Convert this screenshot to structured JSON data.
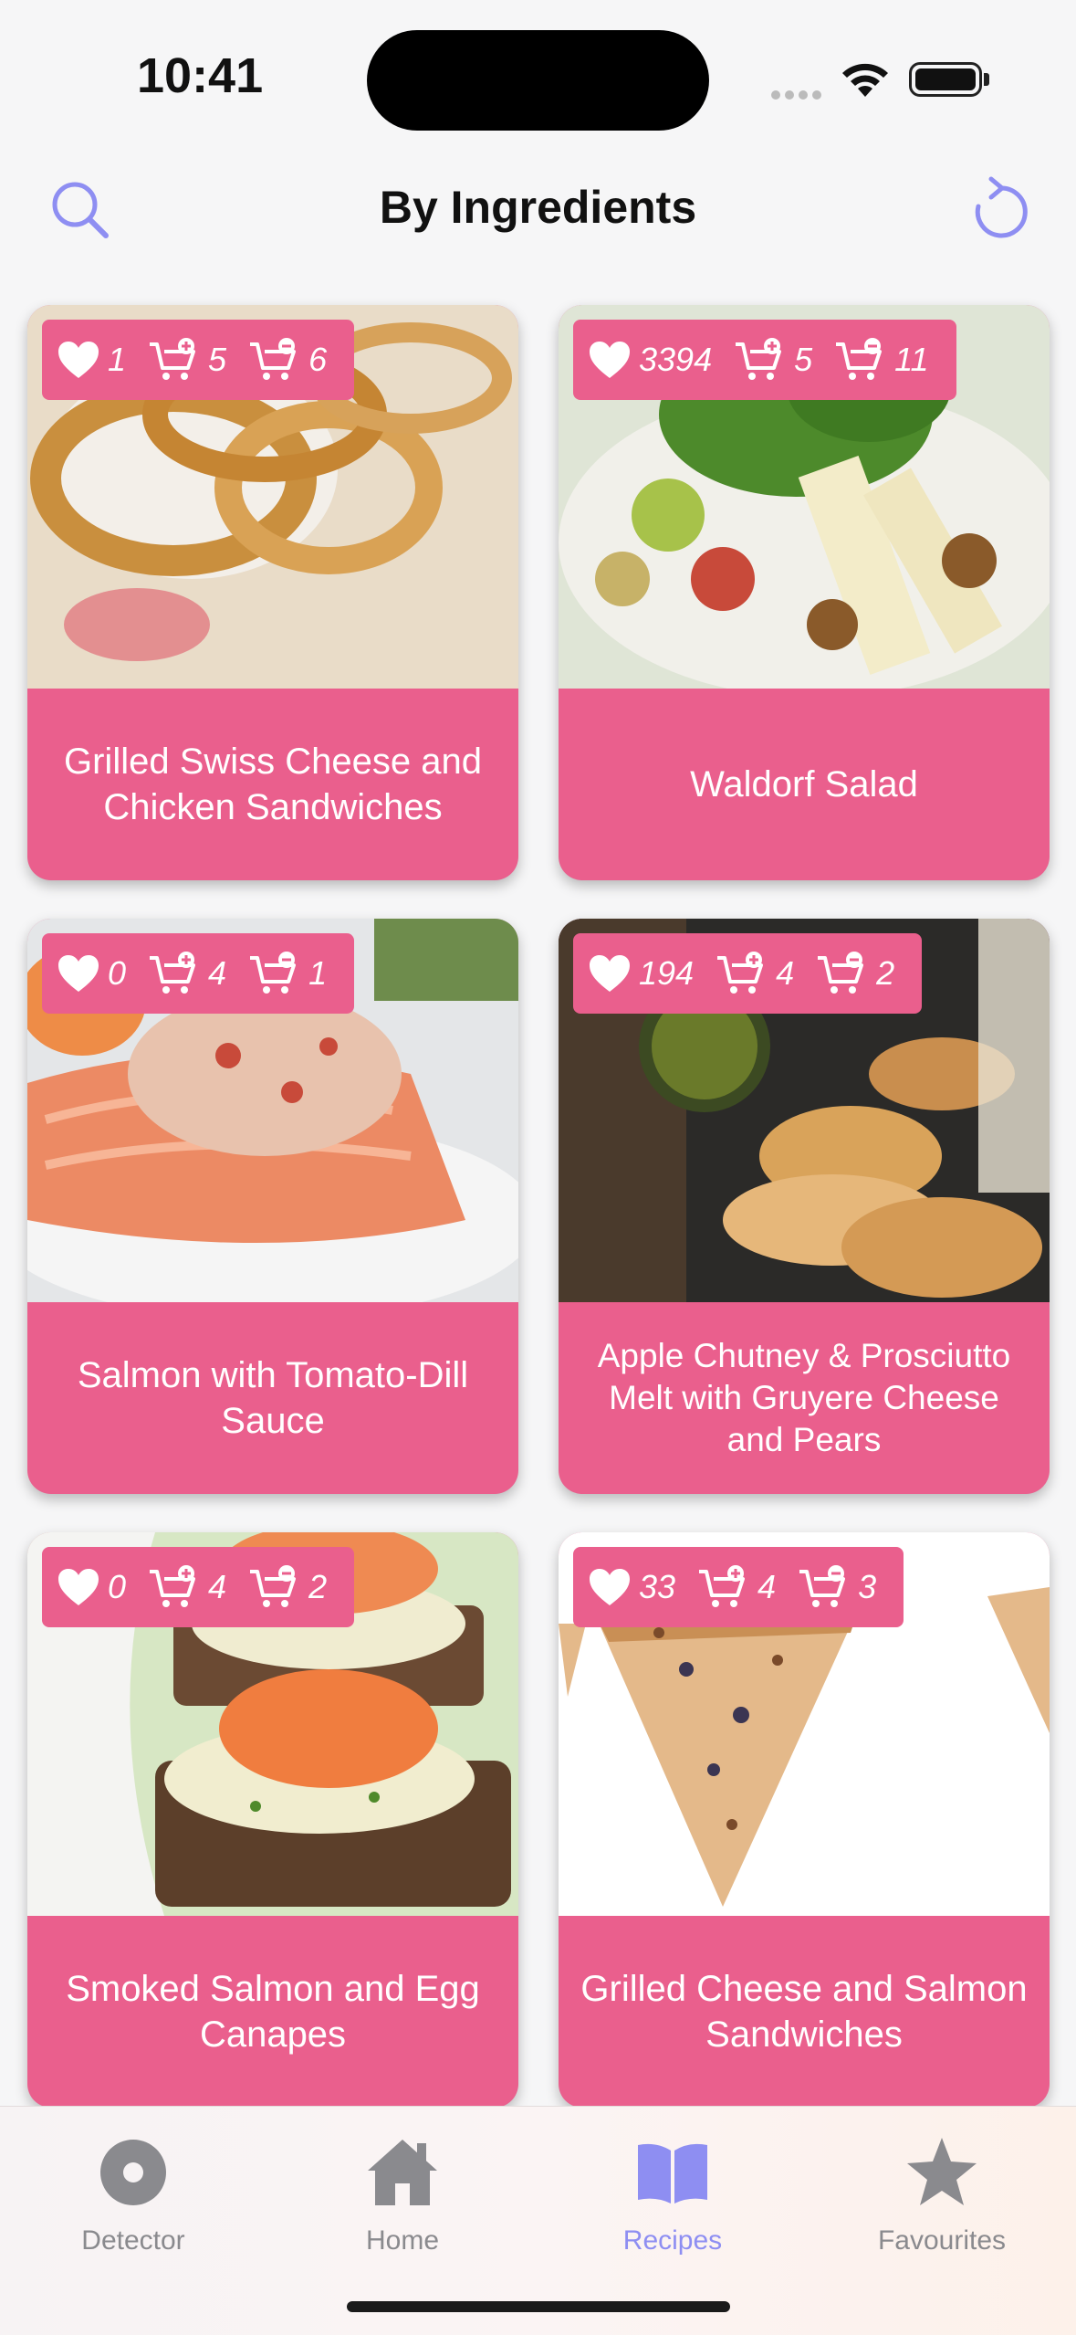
{
  "status": {
    "time": "10:41"
  },
  "header": {
    "title": "By Ingredients"
  },
  "recipes": [
    {
      "title": "Grilled Swiss Cheese and Chicken Sandwiches",
      "likes": "1",
      "cart_add": "5",
      "cart_remove": "6"
    },
    {
      "title": "Waldorf Salad",
      "likes": "3394",
      "cart_add": "5",
      "cart_remove": "11"
    },
    {
      "title": "Salmon with Tomato-Dill Sauce",
      "likes": "0",
      "cart_add": "4",
      "cart_remove": "1"
    },
    {
      "title": "Apple Chutney & Prosciutto Melt with Gruyere Cheese and Pears",
      "likes": "194",
      "cart_add": "4",
      "cart_remove": "2"
    },
    {
      "title": "Smoked Salmon and Egg Canapes",
      "likes": "0",
      "cart_add": "4",
      "cart_remove": "2"
    },
    {
      "title": "Grilled Cheese and Salmon Sandwiches",
      "likes": "33",
      "cart_add": "4",
      "cart_remove": "3"
    }
  ],
  "tabs": [
    {
      "label": "Detector",
      "icon": "detector-icon"
    },
    {
      "label": "Home",
      "icon": "home-icon"
    },
    {
      "label": "Recipes",
      "icon": "book-icon"
    },
    {
      "label": "Favourites",
      "icon": "star-icon"
    }
  ],
  "active_tab": "Recipes",
  "colors": {
    "card": "#ea5f8d",
    "accent": "#8e8ef2",
    "inactive": "#8a8a8e"
  }
}
